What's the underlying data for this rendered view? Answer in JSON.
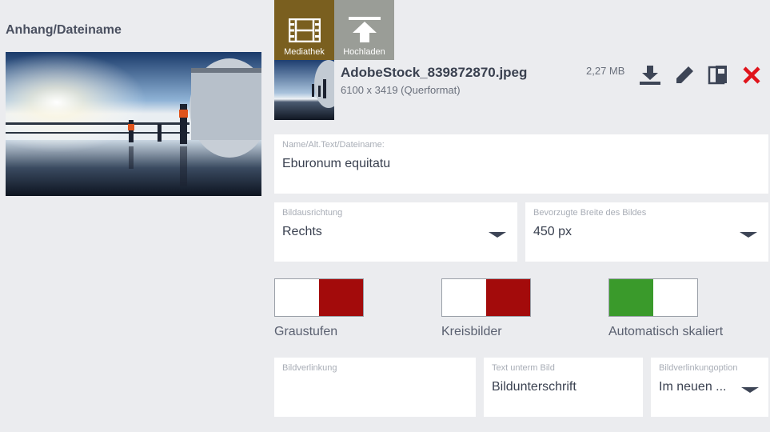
{
  "section": {
    "title": "Anhang/Dateiname"
  },
  "source_buttons": {
    "media_label": "Mediathek",
    "upload_label": "Hochladen",
    "media_color": "#7a5f1f",
    "upload_color": "#9a9d97"
  },
  "file": {
    "name": "AdobeStock_839872870.jpeg",
    "dimensions": "6100 x 3419 (Querformat)",
    "size": "2,27 MB",
    "actions": [
      "download-icon",
      "edit-pencil-icon",
      "replace-file-icon",
      "delete-icon"
    ]
  },
  "fields": {
    "alt_text": {
      "label": "Name/Alt.Text/Dateiname:",
      "value": "Eburonum equitatu"
    },
    "alignment": {
      "label": "Bildausrichtung",
      "value": "Rechts"
    },
    "preferred_width": {
      "label": "Bevorzugte Breite des Bildes",
      "value": "450 px"
    },
    "link": {
      "label": "Bildverlinkung",
      "value": ""
    },
    "caption": {
      "label": "Text unterm Bild",
      "value": "Bildunterschrift"
    },
    "link_option": {
      "label": "Bildverlinkungoption",
      "value": "Im neuen ..."
    }
  },
  "toggles": [
    {
      "label": "Graustufen",
      "state": "off"
    },
    {
      "label": "Kreisbilder",
      "state": "off"
    },
    {
      "label": "Automatisch skaliert",
      "state": "on"
    }
  ],
  "colors": {
    "toggle_off": "#a30b0b",
    "toggle_on": "#3a9a2b",
    "delete": "#e0141c",
    "action_icon": "#3d4556"
  }
}
